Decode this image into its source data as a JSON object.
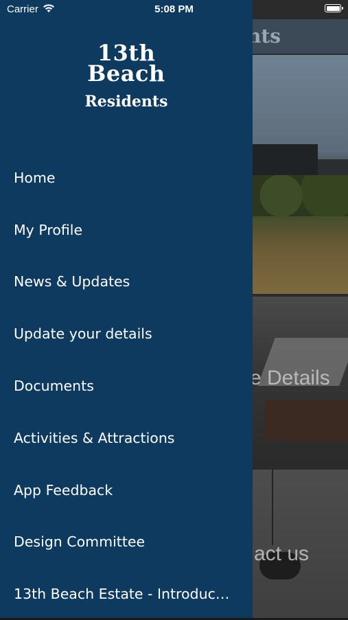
{
  "status_bar": {
    "carrier": "Carrier",
    "time": "5:08 PM"
  },
  "logo": {
    "line1": "13th",
    "line2": "Beach",
    "line3": "Residents"
  },
  "menu": {
    "items": [
      {
        "label": "Home"
      },
      {
        "label": "My Profile"
      },
      {
        "label": "News & Updates"
      },
      {
        "label": "Update your details"
      },
      {
        "label": "Documents"
      },
      {
        "label": "Activities & Attractions"
      },
      {
        "label": "App Feedback"
      },
      {
        "label": "Design Committee"
      },
      {
        "label": "13th Beach Estate - Introduction"
      }
    ]
  },
  "background": {
    "header_title_partial": "nts",
    "tile2_label_partial": "e Details",
    "tile3_label_partial": "act us"
  },
  "colors": {
    "drawer_bg": "#0e3a5f",
    "text": "#ffffff"
  }
}
